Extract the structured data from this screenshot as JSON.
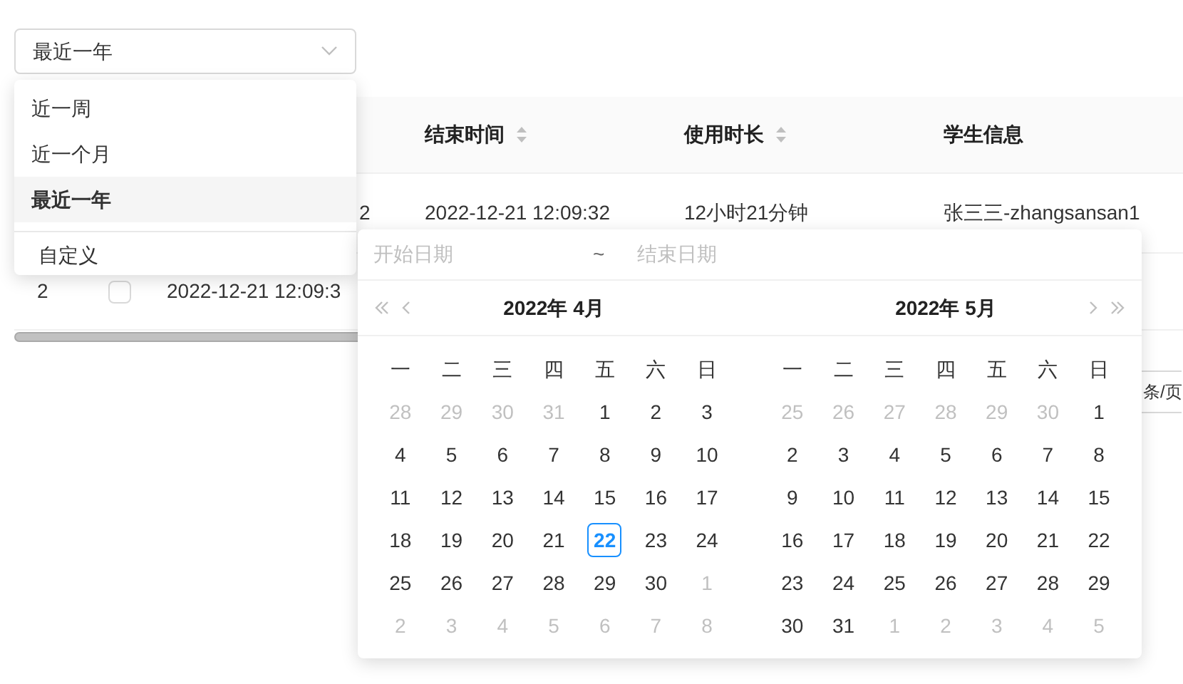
{
  "select": {
    "value": "最近一年",
    "open": true
  },
  "dropdown": {
    "items": [
      {
        "label": "近一周",
        "selected": false
      },
      {
        "label": "近一个月",
        "selected": false
      },
      {
        "label": "最近一年",
        "selected": true
      }
    ],
    "custom": "自定义"
  },
  "table": {
    "columns": [
      {
        "label": "结束时间",
        "sortable": true
      },
      {
        "label": "使用时长",
        "sortable": true
      },
      {
        "label": "学生信息",
        "sortable": false
      }
    ],
    "rows": [
      {
        "start": "2",
        "end": "2022-12-21 12:09:32",
        "duration": "12小时21分钟",
        "student": "张三三-zhangsansan1"
      },
      {
        "index": "2",
        "checked": false,
        "start": "2022-12-21 12:09:3"
      }
    ]
  },
  "pagination": {
    "page_size": "条/页"
  },
  "range_picker": {
    "start_placeholder": "开始日期",
    "separator": "~",
    "end_placeholder": "结束日期",
    "panels": [
      {
        "title": "2022年 4月",
        "weekdays": [
          "一",
          "二",
          "三",
          "四",
          "五",
          "六",
          "日"
        ],
        "weeks": [
          [
            {
              "d": "28",
              "other": true,
              "today": false
            },
            {
              "d": "29",
              "other": true,
              "today": false
            },
            {
              "d": "30",
              "other": true,
              "today": false
            },
            {
              "d": "31",
              "other": true,
              "today": false
            },
            {
              "d": "1",
              "other": false,
              "today": false
            },
            {
              "d": "2",
              "other": false,
              "today": false
            },
            {
              "d": "3",
              "other": false,
              "today": false
            }
          ],
          [
            {
              "d": "4",
              "other": false,
              "today": false
            },
            {
              "d": "5",
              "other": false,
              "today": false
            },
            {
              "d": "6",
              "other": false,
              "today": false
            },
            {
              "d": "7",
              "other": false,
              "today": false
            },
            {
              "d": "8",
              "other": false,
              "today": false
            },
            {
              "d": "9",
              "other": false,
              "today": false
            },
            {
              "d": "10",
              "other": false,
              "today": false
            }
          ],
          [
            {
              "d": "11",
              "other": false,
              "today": false
            },
            {
              "d": "12",
              "other": false,
              "today": false
            },
            {
              "d": "13",
              "other": false,
              "today": false
            },
            {
              "d": "14",
              "other": false,
              "today": false
            },
            {
              "d": "15",
              "other": false,
              "today": false
            },
            {
              "d": "16",
              "other": false,
              "today": false
            },
            {
              "d": "17",
              "other": false,
              "today": false
            }
          ],
          [
            {
              "d": "18",
              "other": false,
              "today": false
            },
            {
              "d": "19",
              "other": false,
              "today": false
            },
            {
              "d": "20",
              "other": false,
              "today": false
            },
            {
              "d": "21",
              "other": false,
              "today": false
            },
            {
              "d": "22",
              "other": false,
              "today": true
            },
            {
              "d": "23",
              "other": false,
              "today": false
            },
            {
              "d": "24",
              "other": false,
              "today": false
            }
          ],
          [
            {
              "d": "25",
              "other": false,
              "today": false
            },
            {
              "d": "26",
              "other": false,
              "today": false
            },
            {
              "d": "27",
              "other": false,
              "today": false
            },
            {
              "d": "28",
              "other": false,
              "today": false
            },
            {
              "d": "29",
              "other": false,
              "today": false
            },
            {
              "d": "30",
              "other": false,
              "today": false
            },
            {
              "d": "1",
              "other": true,
              "today": false
            }
          ],
          [
            {
              "d": "2",
              "other": true,
              "today": false
            },
            {
              "d": "3",
              "other": true,
              "today": false
            },
            {
              "d": "4",
              "other": true,
              "today": false
            },
            {
              "d": "5",
              "other": true,
              "today": false
            },
            {
              "d": "6",
              "other": true,
              "today": false
            },
            {
              "d": "7",
              "other": true,
              "today": false
            },
            {
              "d": "8",
              "other": true,
              "today": false
            }
          ]
        ]
      },
      {
        "title": "2022年 5月",
        "weekdays": [
          "一",
          "二",
          "三",
          "四",
          "五",
          "六",
          "日"
        ],
        "weeks": [
          [
            {
              "d": "25",
              "other": true,
              "today": false
            },
            {
              "d": "26",
              "other": true,
              "today": false
            },
            {
              "d": "27",
              "other": true,
              "today": false
            },
            {
              "d": "28",
              "other": true,
              "today": false
            },
            {
              "d": "29",
              "other": true,
              "today": false
            },
            {
              "d": "30",
              "other": true,
              "today": false
            },
            {
              "d": "1",
              "other": false,
              "today": false
            }
          ],
          [
            {
              "d": "2",
              "other": false,
              "today": false
            },
            {
              "d": "3",
              "other": false,
              "today": false
            },
            {
              "d": "4",
              "other": false,
              "today": false
            },
            {
              "d": "5",
              "other": false,
              "today": false
            },
            {
              "d": "6",
              "other": false,
              "today": false
            },
            {
              "d": "7",
              "other": false,
              "today": false
            },
            {
              "d": "8",
              "other": false,
              "today": false
            }
          ],
          [
            {
              "d": "9",
              "other": false,
              "today": false
            },
            {
              "d": "10",
              "other": false,
              "today": false
            },
            {
              "d": "11",
              "other": false,
              "today": false
            },
            {
              "d": "12",
              "other": false,
              "today": false
            },
            {
              "d": "13",
              "other": false,
              "today": false
            },
            {
              "d": "14",
              "other": false,
              "today": false
            },
            {
              "d": "15",
              "other": false,
              "today": false
            }
          ],
          [
            {
              "d": "16",
              "other": false,
              "today": false
            },
            {
              "d": "17",
              "other": false,
              "today": false
            },
            {
              "d": "18",
              "other": false,
              "today": false
            },
            {
              "d": "19",
              "other": false,
              "today": false
            },
            {
              "d": "20",
              "other": false,
              "today": false
            },
            {
              "d": "21",
              "other": false,
              "today": false
            },
            {
              "d": "22",
              "other": false,
              "today": false
            }
          ],
          [
            {
              "d": "23",
              "other": false,
              "today": false
            },
            {
              "d": "24",
              "other": false,
              "today": false
            },
            {
              "d": "25",
              "other": false,
              "today": false
            },
            {
              "d": "26",
              "other": false,
              "today": false
            },
            {
              "d": "27",
              "other": false,
              "today": false
            },
            {
              "d": "28",
              "other": false,
              "today": false
            },
            {
              "d": "29",
              "other": false,
              "today": false
            }
          ],
          [
            {
              "d": "30",
              "other": false,
              "today": false
            },
            {
              "d": "31",
              "other": false,
              "today": false
            },
            {
              "d": "1",
              "other": true,
              "today": false
            },
            {
              "d": "2",
              "other": true,
              "today": false
            },
            {
              "d": "3",
              "other": true,
              "today": false
            },
            {
              "d": "4",
              "other": true,
              "today": false
            },
            {
              "d": "5",
              "other": true,
              "today": false
            }
          ]
        ]
      }
    ]
  }
}
